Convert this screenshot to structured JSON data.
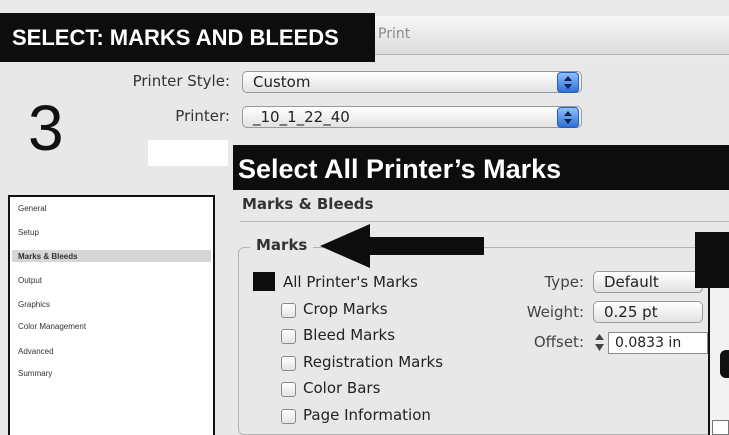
{
  "window": {
    "title": "Print"
  },
  "banners": {
    "step_title": "SELECT: MARKS AND BLEEDS",
    "instruction": "Select All Printer’s Marks",
    "step_number": "3"
  },
  "header": {
    "printer_style_label": "Printer Style:",
    "printer_style_value": "Custom",
    "printer_label": "Printer:",
    "printer_value": "_10_1_22_40"
  },
  "sidebar": {
    "items": [
      {
        "label": "General"
      },
      {
        "label": "Setup"
      },
      {
        "label": "Marks & Bleeds",
        "selected": true
      },
      {
        "label": "Output"
      },
      {
        "label": "Graphics"
      },
      {
        "label": "Color Management"
      },
      {
        "label": "Advanced"
      },
      {
        "label": "Summary"
      }
    ]
  },
  "main": {
    "section_title": "Marks & Bleeds",
    "marks_group_label": "Marks",
    "checkboxes": [
      {
        "label": "All Printer's Marks",
        "checked": true
      },
      {
        "label": "Crop Marks",
        "checked": false
      },
      {
        "label": "Bleed Marks",
        "checked": false
      },
      {
        "label": "Registration Marks",
        "checked": false
      },
      {
        "label": "Color Bars",
        "checked": false
      },
      {
        "label": "Page Information",
        "checked": false
      }
    ],
    "type_label": "Type:",
    "type_value": "Default",
    "weight_label": "Weight:",
    "weight_value": "0.25 pt",
    "offset_label": "Offset:",
    "offset_value": "0.0833 in"
  },
  "icons": [
    "arrow-left-icon",
    "popup-stepper-icon",
    "stepper-arrows-icon"
  ],
  "colors": {
    "banner_bg": "#0d0d0d",
    "banner_text": "#ffffff",
    "accent_blue": "#2f6fd6"
  }
}
